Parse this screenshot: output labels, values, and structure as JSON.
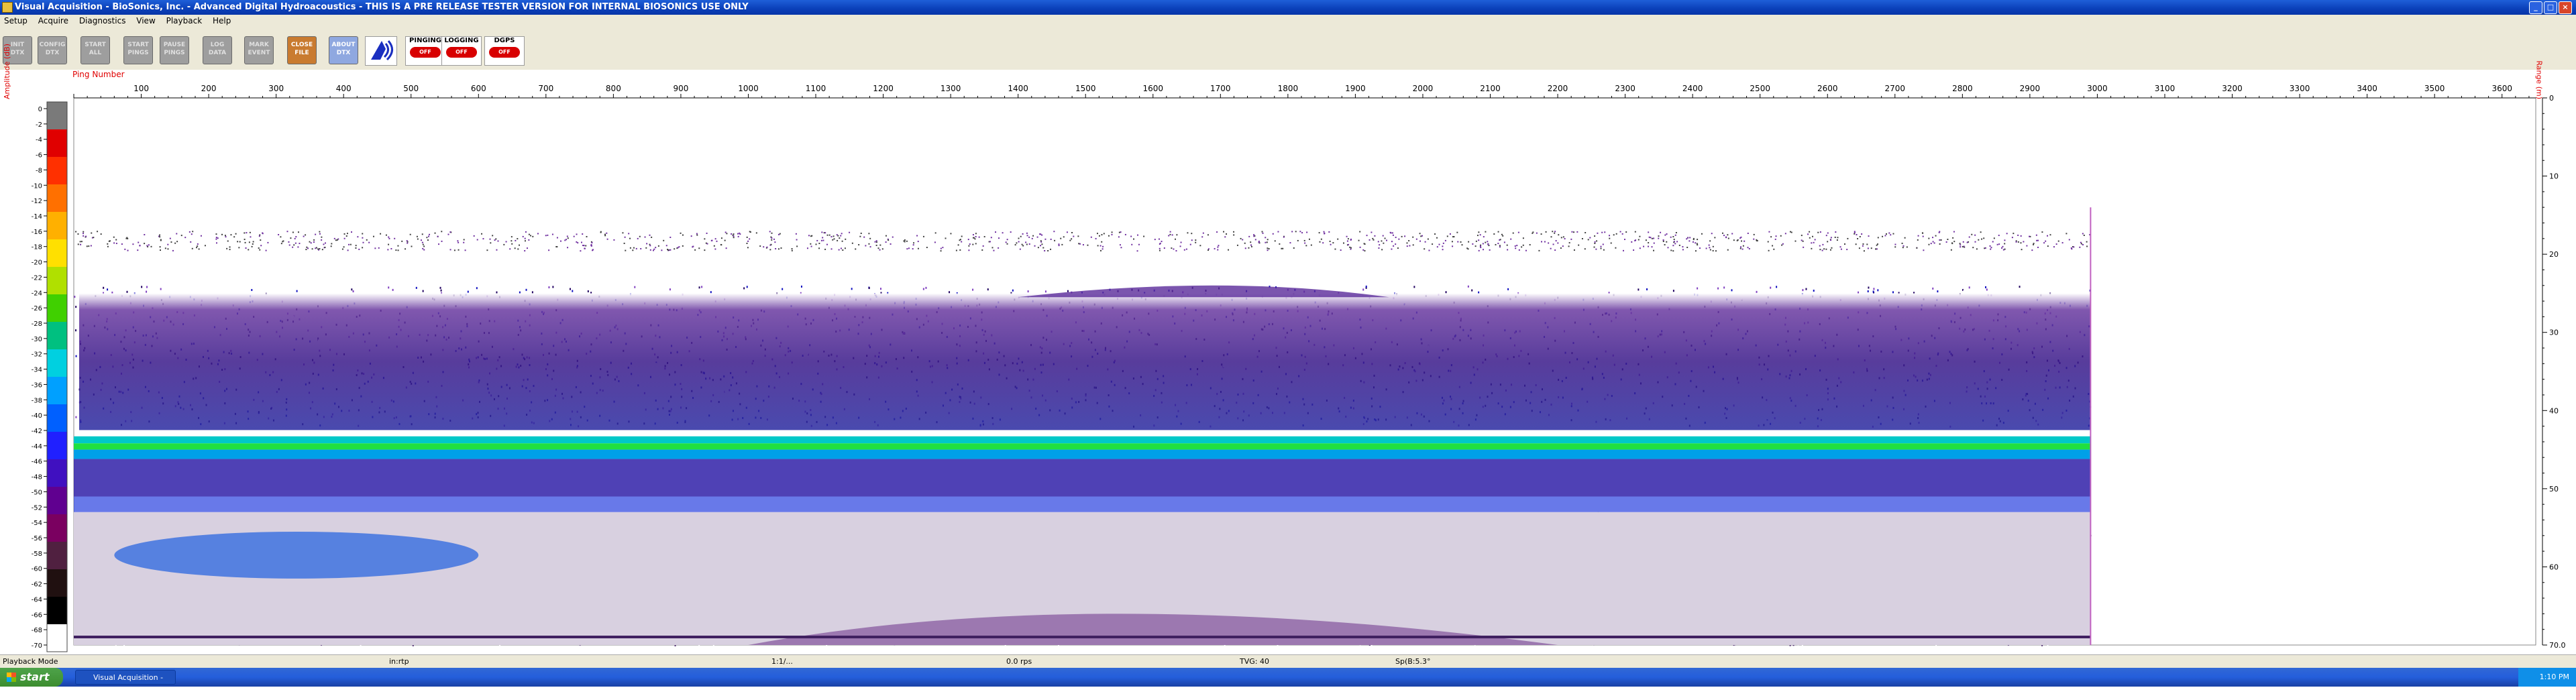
{
  "window": {
    "title": "Visual Acquisition  -  BioSonics, Inc.  -  Advanced Digital Hydroacoustics  -  THIS IS A PRE RELEASE TESTER VERSION FOR INTERNAL BIOSONICS USE ONLY"
  },
  "menu": [
    "Setup",
    "Acquire",
    "Diagnostics",
    "View",
    "Playback",
    "Help"
  ],
  "toolbar": {
    "buttons": [
      {
        "label": "INIT\nDTX",
        "state": "disabled"
      },
      {
        "label": "CONFIG\nDTX",
        "state": "disabled"
      },
      {
        "label": "START\nALL",
        "state": "disabled"
      },
      {
        "label": "START\nPINGS",
        "state": "disabled"
      },
      {
        "label": "PAUSE\nPINGS",
        "state": "disabled"
      },
      {
        "label": "LOG\nDATA",
        "state": "disabled"
      },
      {
        "label": "MARK\nEVENT",
        "state": "disabled"
      },
      {
        "label": "CLOSE\nFILE",
        "state": "active-orange"
      },
      {
        "label": "ABOUT\nDTX",
        "state": "active-blue"
      }
    ],
    "indicators": [
      {
        "label": "PINGING",
        "led_text": "OFF"
      },
      {
        "label": "LOGGING",
        "led_text": "OFF"
      },
      {
        "label": "DGPS",
        "led_text": "OFF"
      }
    ]
  },
  "echogram": {
    "x_axis_title": "Ping Number",
    "x_ticks": [
      "100",
      "200",
      "300",
      "400",
      "500",
      "600",
      "700",
      "800",
      "900",
      "1000",
      "1100",
      "1200",
      "1300",
      "1400",
      "1500",
      "1600",
      "1700",
      "1800",
      "1900",
      "2000",
      "2100",
      "2200",
      "2300",
      "2400",
      "2500",
      "2600",
      "2700",
      "2800",
      "2900",
      "3000",
      "3100",
      "3200",
      "3300",
      "3400",
      "3500",
      "3600"
    ],
    "amp_axis_title": "Amplitude (dB)",
    "amp_ticks": [
      "0",
      "-2",
      "-4",
      "-6",
      "-8",
      "-10",
      "-12",
      "-14",
      "-16",
      "-18",
      "-20",
      "-22",
      "-24",
      "-26",
      "-28",
      "-30",
      "-32",
      "-34",
      "-36",
      "-38",
      "-40",
      "-42",
      "-44",
      "-46",
      "-48",
      "-50",
      "-52",
      "-54",
      "-56",
      "-58",
      "-60",
      "-62",
      "-64",
      "-66",
      "-68",
      "-70"
    ],
    "depth_axis_title": "Range (m)",
    "depth_ticks": [
      "0",
      "10",
      "20",
      "30",
      "40",
      "50",
      "60",
      "70.0"
    ],
    "colorbar_colors": [
      "#7a7a7a",
      "#e00000",
      "#ff3000",
      "#ff7000",
      "#ffb000",
      "#ffe000",
      "#b0e000",
      "#40d000",
      "#00c080",
      "#00d0e0",
      "#00a0ff",
      "#0060ff",
      "#2020ff",
      "#4010c0",
      "#600090",
      "#7a0060",
      "#502040",
      "#201010",
      "#000000",
      "#ffffff"
    ],
    "data_extent_last_ping": 2990,
    "bottom_band_depth_m": 44.6
  },
  "status": {
    "mode": "Playback Mode",
    "field2": "in:rtp",
    "field3": "1:1/...",
    "field4": "0.0 rps",
    "field5": "TVG: 40",
    "field6": "Sp(B:5.3°"
  },
  "taskbar": {
    "start_label": "start",
    "task_label": "Visual Acquisition - B...",
    "clock": "1:10 PM"
  }
}
